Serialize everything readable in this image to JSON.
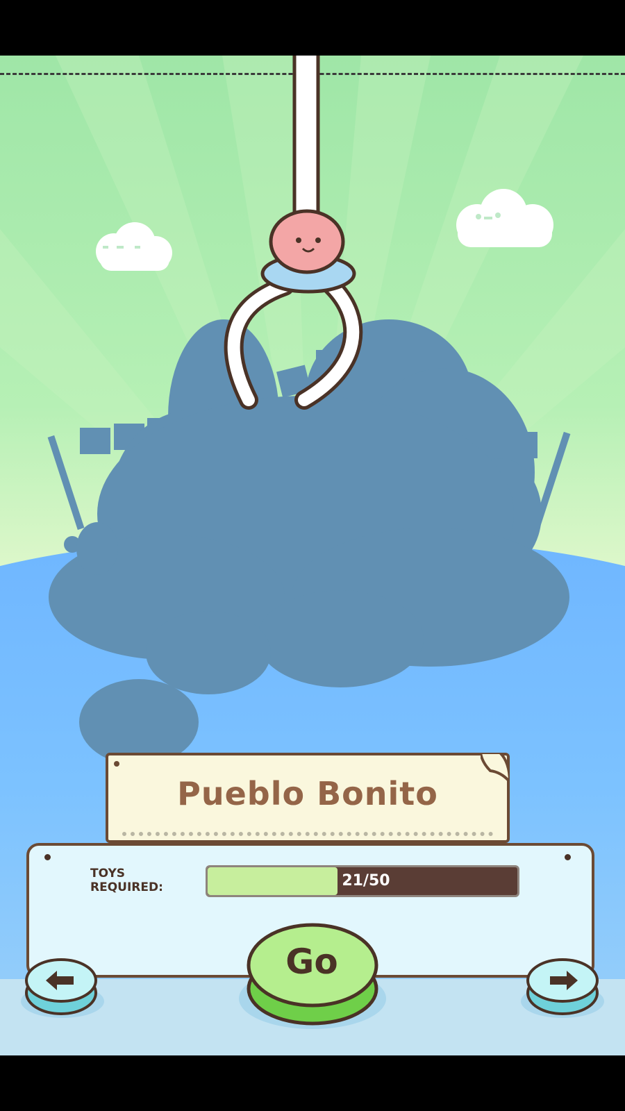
{
  "level": {
    "name": "Pueblo Bonito",
    "toys_label_line1": "TOYS",
    "toys_label_line2": "REQUIRED:",
    "progress_text": "21/50",
    "progress_fraction": 0.42
  },
  "controls": {
    "go_label": "Go",
    "prev_icon": "arrow-left-icon",
    "next_icon": "arrow-right-icon"
  },
  "colors": {
    "sky_top": "#9fe6a7",
    "ground": "#7cc2ff",
    "silhouette": "#6190b3",
    "outline": "#6b4a34",
    "progress_fill": "#c7ee9d",
    "go_button": "#7ed957"
  }
}
